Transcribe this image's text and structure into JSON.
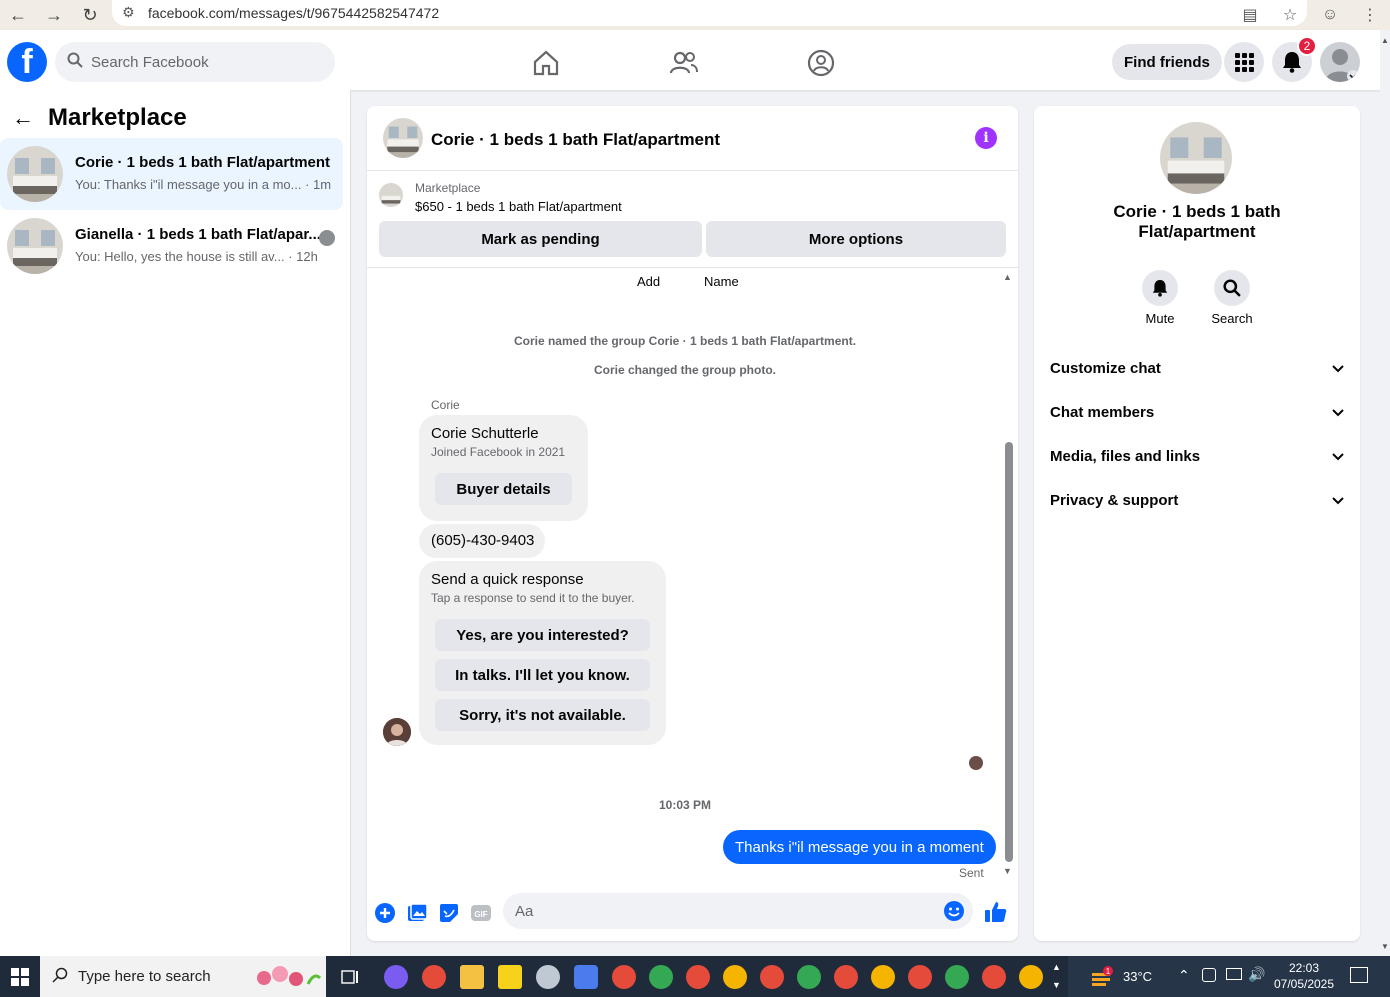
{
  "browser": {
    "url": "facebook.com/messages/t/9675442582547472"
  },
  "header": {
    "search_placeholder": "Search Facebook",
    "find_friends": "Find friends",
    "notification_count": "2"
  },
  "sidebar": {
    "title": "Marketplace",
    "conversations": [
      {
        "title": "Corie · 1 beds 1 bath Flat/apartment",
        "preview": "You: Thanks i\"il message you in a mo... · 1m"
      },
      {
        "title": "Gianella · 1 beds 1 bath Flat/apar...",
        "preview": "You: Hello, yes the house is still av... · 12h"
      }
    ]
  },
  "chat": {
    "title": "Corie · 1 beds 1 bath Flat/apartment",
    "listing_label": "Marketplace",
    "listing_price": "$650 - 1 beds 1 bath Flat/apartment",
    "mark_pending": "Mark as pending",
    "more_options": "More options",
    "add_label": "Add",
    "name_label": "Name",
    "sys_named": "Corie named the group Corie · 1 beds 1 bath Flat/apartment.",
    "sys_photo": "Corie changed the group photo.",
    "sender": "Corie",
    "buyer_name": "Corie Schutterle",
    "buyer_joined": "Joined Facebook in 2021",
    "buyer_details": "Buyer details",
    "phone": "(605)-430-9403",
    "quick_title": "Send a quick response",
    "quick_sub": "Tap a response to send it to the buyer.",
    "quick_1": "Yes, are you interested?",
    "quick_2": "In talks. I'll let you know.",
    "quick_3": "Sorry, it's not available.",
    "time": "10:03 PM",
    "my_message": "Thanks i\"il message you in a moment",
    "sent": "Sent",
    "composer_placeholder": "Aa",
    "gif": "GIF"
  },
  "details": {
    "name": "Corie · 1 beds 1 bath Flat/apartment",
    "mute": "Mute",
    "search": "Search",
    "sections": [
      "Customize chat",
      "Chat members",
      "Media, files and links",
      "Privacy & support"
    ]
  },
  "taskbar": {
    "search_placeholder": "Type here to search",
    "temperature": "33°C",
    "time": "22:03",
    "date": "07/05/2025",
    "weather_badge": "1"
  },
  "colors": {
    "brand": "#0866ff",
    "info": "#a033ff",
    "badge": "#e41e3f"
  }
}
